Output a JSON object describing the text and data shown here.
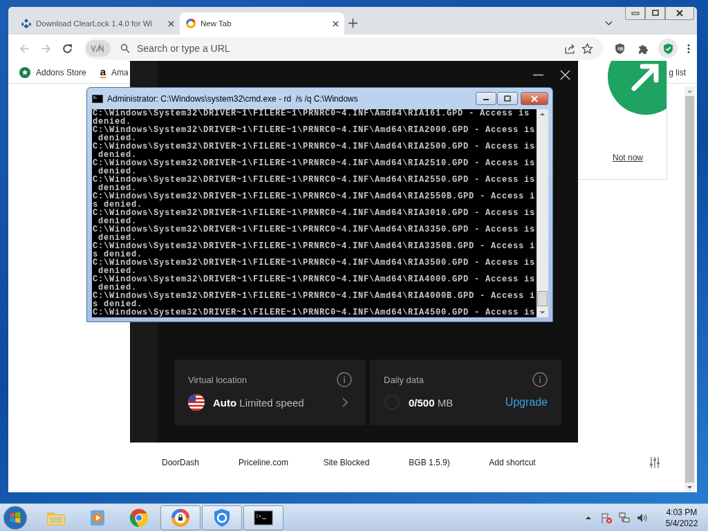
{
  "browser": {
    "tabs": [
      {
        "title": "Download ClearLock 1.4.0 for Wi",
        "selected": false,
        "kind": "download"
      },
      {
        "title": "New Tab",
        "selected": true,
        "kind": "browser"
      }
    ],
    "address_bar": {
      "placeholder": "Search or type a URL"
    },
    "bookmarks": [
      {
        "label": "Addons Store",
        "kind": "store"
      },
      {
        "label": "Ama",
        "kind": "letter",
        "icon_text": "a"
      }
    ],
    "bookmarks_right": "g list",
    "shortcuts": [
      "DoorDash",
      "Priceline.com",
      "Site Blocked",
      "BGB 1.5.9)",
      "Add shortcut"
    ],
    "prompt": {
      "link": "Not now"
    }
  },
  "vpn_window": {
    "cards": [
      {
        "kind": "location",
        "title": "Virtual location",
        "value": "**Auto** Limited speed"
      },
      {
        "kind": "data",
        "title": "Daily data",
        "value": "**0/500** MB",
        "action": "Upgrade"
      }
    ]
  },
  "console": {
    "title": "Administrator: C:\\Windows\\system32\\cmd.exe - rd  /s /q C:\\Windows",
    "lines": [
      "C:\\Windows\\System32\\DRIVER~1\\FILERE~1\\PRNRC0~4.INF\\Amd64\\RIA161.GPD - Access is",
      "denied.",
      "C:\\Windows\\System32\\DRIVER~1\\FILERE~1\\PRNRC0~4.INF\\Amd64\\RIA2000.GPD - Access is",
      " denied.",
      "C:\\Windows\\System32\\DRIVER~1\\FILERE~1\\PRNRC0~4.INF\\Amd64\\RIA2500.GPD - Access is",
      " denied.",
      "C:\\Windows\\System32\\DRIVER~1\\FILERE~1\\PRNRC0~4.INF\\Amd64\\RIA2510.GPD - Access is",
      " denied.",
      "C:\\Windows\\System32\\DRIVER~1\\FILERE~1\\PRNRC0~4.INF\\Amd64\\RIA2550.GPD - Access is",
      " denied.",
      "C:\\Windows\\System32\\DRIVER~1\\FILERE~1\\PRNRC0~4.INF\\Amd64\\RIA2550B.GPD - Access i",
      "s denied.",
      "C:\\Windows\\System32\\DRIVER~1\\FILERE~1\\PRNRC0~4.INF\\Amd64\\RIA3010.GPD - Access is",
      " denied.",
      "C:\\Windows\\System32\\DRIVER~1\\FILERE~1\\PRNRC0~4.INF\\Amd64\\RIA3350.GPD - Access is",
      " denied.",
      "C:\\Windows\\System32\\DRIVER~1\\FILERE~1\\PRNRC0~4.INF\\Amd64\\RIA3350B.GPD - Access i",
      "s denied.",
      "C:\\Windows\\System32\\DRIVER~1\\FILERE~1\\PRNRC0~4.INF\\Amd64\\RIA3500.GPD - Access is",
      " denied.",
      "C:\\Windows\\System32\\DRIVER~1\\FILERE~1\\PRNRC0~4.INF\\Amd64\\RIA4000.GPD - Access is",
      " denied.",
      "C:\\Windows\\System32\\DRIVER~1\\FILERE~1\\PRNRC0~4.INF\\Amd64\\RIA4000B.GPD - Access i",
      "s denied.",
      "C:\\Windows\\System32\\DRIVER~1\\FILERE~1\\PRNRC0~4.INF\\Amd64\\RIA4500.GPD - Access is"
    ]
  },
  "taskbar": {
    "apps": [
      {
        "kind": "explorer",
        "running": false
      },
      {
        "kind": "media",
        "running": false
      },
      {
        "kind": "chrome",
        "running": false
      },
      {
        "kind": "lock",
        "running": true
      },
      {
        "kind": "shield",
        "running": true
      },
      {
        "kind": "cmd",
        "running": true
      }
    ],
    "time": "4:03 PM",
    "date": "5/4/2022"
  }
}
